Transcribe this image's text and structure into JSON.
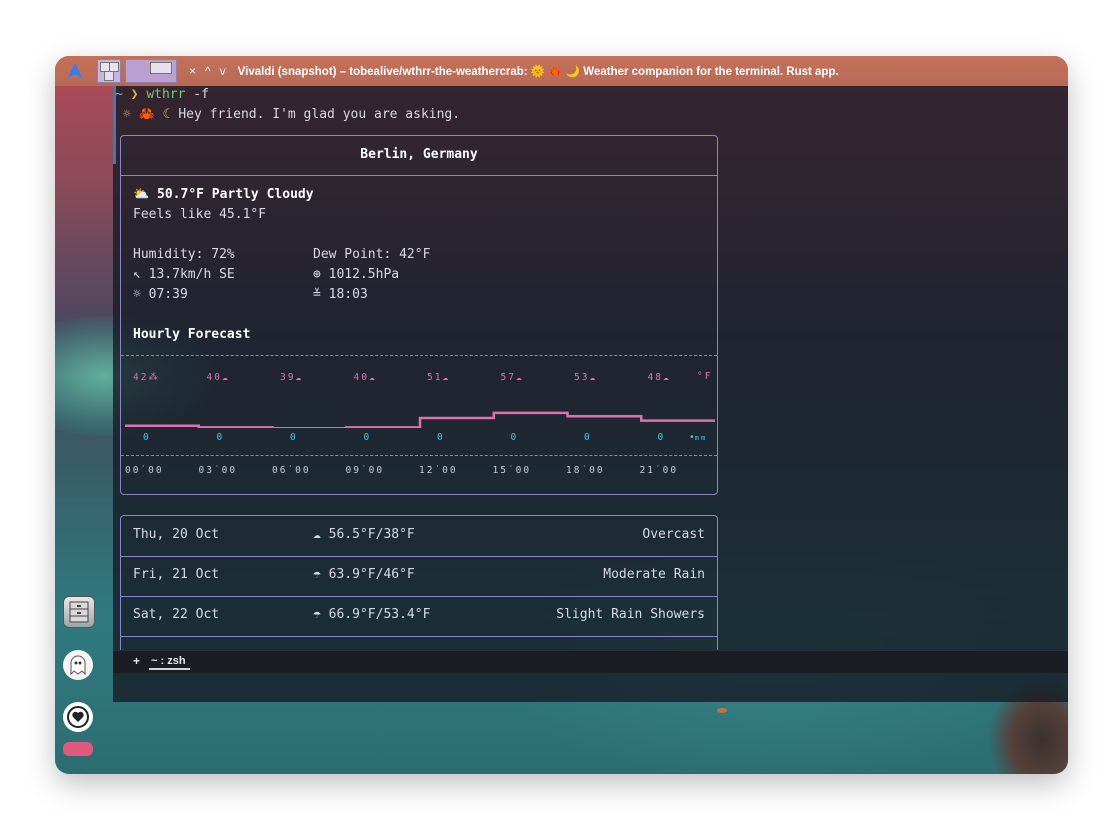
{
  "panel": {
    "launcher_icon": "arch-logo-icon",
    "window_controls": [
      "×",
      "^",
      "v"
    ],
    "title": "Vivaldi (snapshot) – tobealive/wthrr-the-weathercrab: 🌞 🦀 🌙 Weather companion for the terminal. Rust app."
  },
  "terminal": {
    "prompt_tilde": "~",
    "prompt_arrow": "❯",
    "command": "wthrr",
    "command_arg": "-f",
    "greeting_icons": "☼ 🦀 ☾",
    "greeting": "Hey friend. I'm glad you are asking.",
    "location": "Berlin, Germany",
    "current": {
      "icon": "⛅",
      "temp_summary": "50.7°F Partly Cloudy",
      "feels_like": "Feels like 45.1°F",
      "humidity": "Humidity: 72%",
      "dew_point": "Dew Point: 42°F",
      "wind": "↖ 13.7km/h SE",
      "pressure": "⊕ 1012.5hPa",
      "sunrise": "☼ 07:39",
      "sunset": "≚ 18:03"
    },
    "hourly_heading": "Hourly Forecast",
    "hourly": {
      "temps": [
        "42⁂",
        "40☁",
        "39☁",
        "40☁",
        "51☁",
        "57☁",
        "53☁",
        "48☁"
      ],
      "unit": "°F",
      "precip": [
        "0",
        "0",
        "0",
        "0",
        "0",
        "0",
        "0",
        "0"
      ],
      "precip_unit": "mm",
      "times": [
        "00˙00",
        "03˙00",
        "06˙00",
        "09˙00",
        "12˙00",
        "15˙00",
        "18˙00",
        "21˙00"
      ],
      "temp_line": [
        42,
        40,
        39,
        40,
        51,
        57,
        53,
        48
      ]
    },
    "daily": [
      {
        "date": "Thu, 20 Oct",
        "temps": "☁ 56.5°F/38°F",
        "condition": "Overcast"
      },
      {
        "date": "Fri, 21 Oct",
        "temps": "☂ 63.9°F/46°F",
        "condition": "Moderate Rain"
      },
      {
        "date": "Sat, 22 Oct",
        "temps": "☂ 66.9°F/53.4°F",
        "condition": "Slight Rain Showers"
      }
    ],
    "tab_plus": "+",
    "tab_label": "~ : zsh"
  },
  "colors": {
    "border": "#8c84c8",
    "temp": "#e070b0",
    "precip": "#45c4e8"
  }
}
